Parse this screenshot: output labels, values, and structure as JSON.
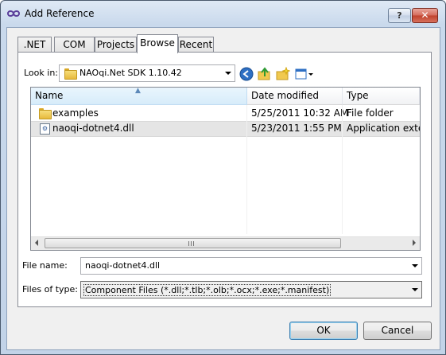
{
  "window": {
    "title": "Add Reference"
  },
  "title_buttons": {
    "help": "?",
    "close": "✕"
  },
  "tabs": [
    {
      "label": ".NET",
      "active": false
    },
    {
      "label": "COM",
      "active": false
    },
    {
      "label": "Projects",
      "active": false
    },
    {
      "label": "Browse",
      "active": true
    },
    {
      "label": "Recent",
      "active": false
    }
  ],
  "look_in": {
    "label": "Look in:",
    "value": "NAOqi.Net SDK 1.10.42",
    "toolbar_icons": [
      "back-icon",
      "up-folder-icon",
      "new-folder-icon",
      "view-menu-icon"
    ]
  },
  "file_list": {
    "columns": [
      "Name",
      "Date modified",
      "Type"
    ],
    "rows": [
      {
        "name": "examples",
        "date": "5/25/2011 10:32 AM",
        "type": "File folder",
        "icon": "folder-icon",
        "selected": false
      },
      {
        "name": "naoqi-dotnet4.dll",
        "date": "5/23/2011 1:55 PM",
        "type": "Application exter",
        "icon": "dll-file-icon",
        "selected": true
      }
    ]
  },
  "file_name": {
    "label": "File name:",
    "value": "naoqi-dotnet4.dll"
  },
  "files_of_type": {
    "label": "Files of type:",
    "value": "Component Files (*.dll;*.tlb;*.olb;*.ocx;*.exe;*.manifest)"
  },
  "buttons": {
    "ok": "OK",
    "cancel": "Cancel"
  },
  "colors": {
    "title_gradient": "#c9d9ec",
    "close_button": "#c0412c",
    "selection": "#e5e5e5"
  }
}
